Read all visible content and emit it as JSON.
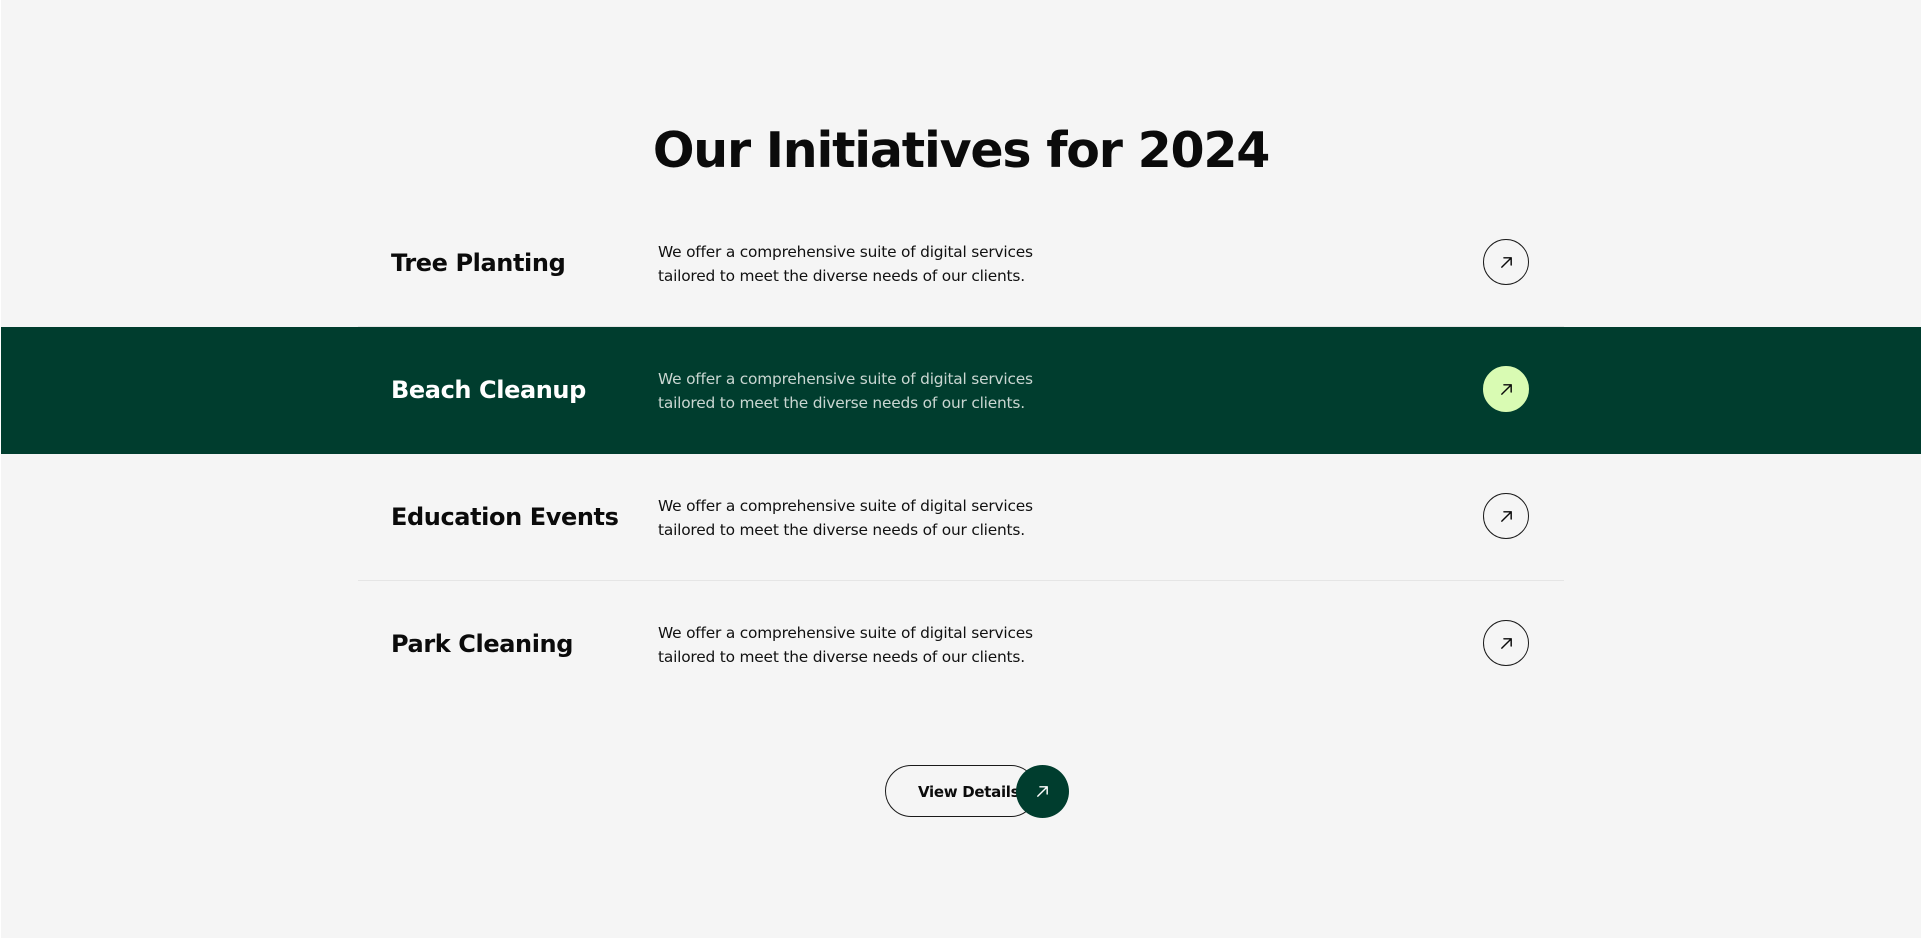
{
  "section": {
    "title": "Our Initiatives for 2024"
  },
  "initiatives": [
    {
      "title": "Tree Planting",
      "description": "We offer a comprehensive suite of digital services tailored to meet the diverse needs of our clients.",
      "icon": "arrow-up-right-icon",
      "active": false
    },
    {
      "title": "Beach Cleanup",
      "description": "We offer a comprehensive suite of digital services tailored to meet the diverse needs of our clients.",
      "icon": "arrow-up-right-icon",
      "active": true
    },
    {
      "title": "Education Events",
      "description": "We offer a comprehensive suite of digital services tailored to meet the diverse needs of our clients.",
      "icon": "arrow-up-right-icon",
      "active": false
    },
    {
      "title": "Park Cleaning",
      "description": "We offer a comprehensive suite of digital services tailored to meet the diverse needs of our clients.",
      "icon": "arrow-up-right-icon",
      "active": false
    }
  ],
  "cta": {
    "label": "View Details",
    "icon": "arrow-up-right-icon"
  },
  "colors": {
    "background": "#f5f5f5",
    "active_row": "#003d2e",
    "active_arrow": "#d9fbb3",
    "text": "#0b0b0b",
    "cta_circle": "#003d2e"
  }
}
